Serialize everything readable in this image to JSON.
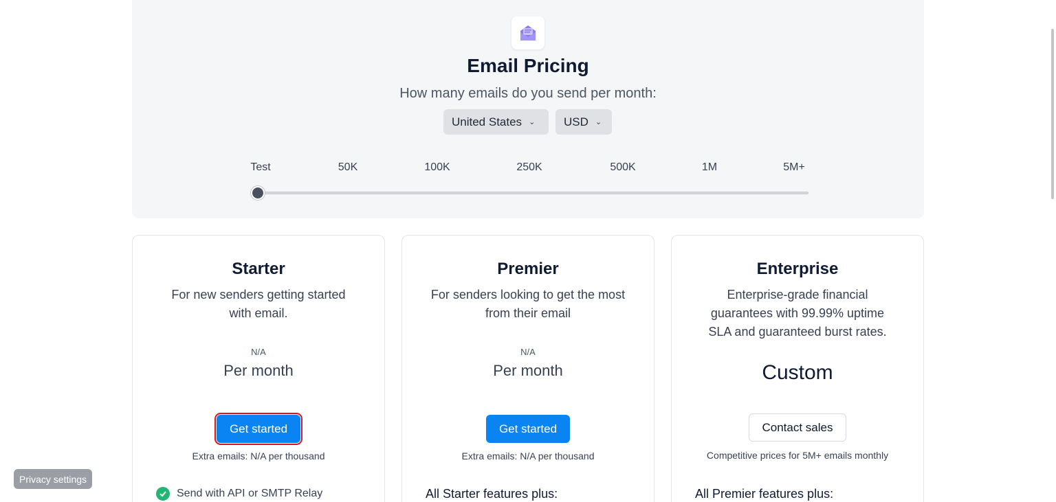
{
  "header": {
    "icon": "envelope-icon",
    "title": "Email Pricing",
    "subtitle": "How many emails do you send per month:",
    "country_select": "United States",
    "currency_select": "USD"
  },
  "slider": {
    "ticks": [
      "Test",
      "50K",
      "100K",
      "250K",
      "500K",
      "1M",
      "5M+"
    ],
    "selected": "Test",
    "position_fraction": 0
  },
  "plans": [
    {
      "name": "Starter",
      "description": "For new senders getting started with email.",
      "price": "N/A",
      "period": "Per month",
      "cta": "Get started",
      "extra": "Extra emails: N/A per thousand",
      "feature_heading": "",
      "first_feature": "Send with API or SMTP Relay"
    },
    {
      "name": "Premier",
      "description": "For senders looking to get the most from their email",
      "price": "N/A",
      "period": "Per month",
      "cta": "Get started",
      "extra": "Extra emails: N/A per thousand",
      "feature_heading": "All Starter features plus:"
    },
    {
      "name": "Enterprise",
      "description": "Enterprise-grade financial guarantees with 99.99% uptime SLA and guaranteed burst rates.",
      "price": "Custom",
      "cta": "Contact sales",
      "extra": "Competitive prices for 5M+ emails monthly",
      "feature_heading": "All Premier features plus:"
    }
  ],
  "privacy_button": "Privacy settings",
  "colors": {
    "primary_button": "#0b84f3",
    "check": "#22b573",
    "hero_bg": "#f5f6f8",
    "selection_outline": "#e0131c"
  }
}
